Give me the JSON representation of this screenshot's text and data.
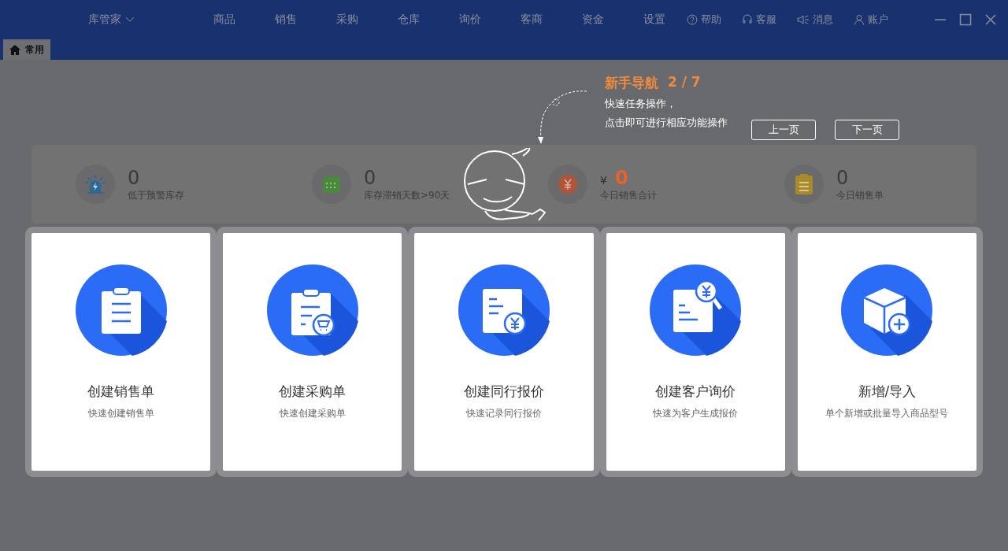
{
  "app_title": "库管家",
  "nav_items": [
    {
      "label": "商品"
    },
    {
      "label": "销售"
    },
    {
      "label": "采购"
    },
    {
      "label": "仓库"
    },
    {
      "label": "询价"
    },
    {
      "label": "客商"
    },
    {
      "label": "资金"
    },
    {
      "label": "设置"
    }
  ],
  "tools": [
    {
      "label": "帮助",
      "kind": "help"
    },
    {
      "label": "客服",
      "kind": "service"
    },
    {
      "label": "消息",
      "kind": "message"
    },
    {
      "label": "账户",
      "kind": "account"
    }
  ],
  "tabs": [
    {
      "label": "常用",
      "selected": true
    }
  ],
  "guide": {
    "title": "新手导航",
    "step": "2 / 7",
    "lines": [
      "快速任务操作，",
      "点击即可进行相应功能操作"
    ],
    "buttons": [
      "上一页",
      "下一页"
    ]
  },
  "stats": [
    {
      "kind": "alarm",
      "value": "0",
      "label": "低于预警库存"
    },
    {
      "kind": "calendar",
      "value": "0",
      "label": "库存滞销天数>90天"
    },
    {
      "kind": "yen",
      "currency": "¥",
      "value": "0",
      "label": "今日销售合计"
    },
    {
      "kind": "clipboard",
      "value": "0",
      "label": "今日销售单"
    }
  ],
  "cards": [
    {
      "kind": "sale",
      "title": "创建销售单",
      "subtitle": "快速创建销售单"
    },
    {
      "kind": "purchase",
      "title": "创建采购单",
      "subtitle": "快速创建采购单"
    },
    {
      "kind": "quote",
      "title": "创建同行报价",
      "subtitle": "快速记录同行报价"
    },
    {
      "kind": "inquiry",
      "title": "创建客户询价",
      "subtitle": "快速为客户生成报价"
    },
    {
      "kind": "import",
      "title": "新增/导入",
      "subtitle": "单个新增或批量导入商品型号"
    }
  ]
}
